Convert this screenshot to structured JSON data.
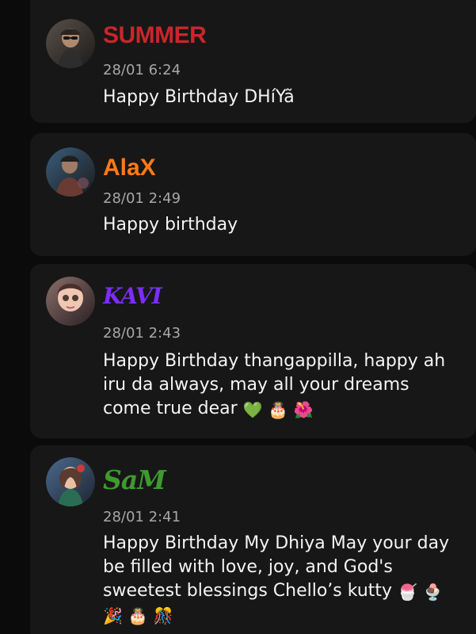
{
  "colors": {
    "background": "#0b0b0b",
    "card": "#171717",
    "timestamp": "#a7a7a7",
    "message_text": "#f4f4f4"
  },
  "posts": [
    {
      "name": "SUMMER",
      "name_color": "#c9262c",
      "timestamp": "28/01 6:24",
      "message_text": "Happy Birthday DHíYã",
      "emojis": []
    },
    {
      "name": "AlaX",
      "name_color": "#ff7a17",
      "timestamp": "28/01 2:49",
      "message_text": "Happy birthday",
      "emojis": []
    },
    {
      "name": "KAVI",
      "name_color": "#7d2cff",
      "timestamp": "28/01 2:43",
      "message_text": "Happy Birthday thangappilla, happy ah iru da always, may all your dreams come true dear",
      "emojis": [
        "💚",
        "🎂",
        "🌺"
      ]
    },
    {
      "name": "SaM",
      "name_color": "#3f9a2f",
      "timestamp": "28/01 2:41",
      "message_text": "Happy Birthday My Dhiya May your day be filled with love, joy, and God's sweetest blessings Chello’s kutty",
      "emojis": [
        "🍧",
        "🍨",
        "🎉",
        "🎂",
        "🎊"
      ]
    }
  ]
}
